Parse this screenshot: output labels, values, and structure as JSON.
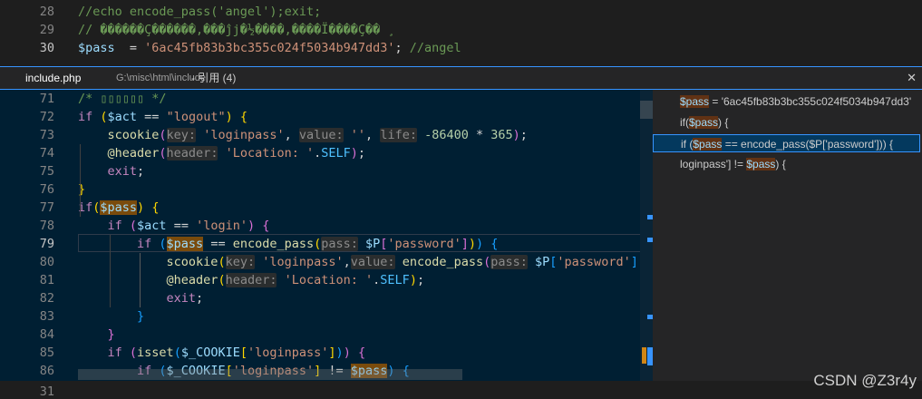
{
  "editor_top": {
    "lines": [
      {
        "num": "28",
        "parts": [
          {
            "t": "//echo encode_pass('angel');exit;",
            "c": "cm"
          }
        ]
      },
      {
        "num": "29",
        "parts": [
          {
            "t": "// ������Ç������,���ĵj�½����,����Ï����Ç�� ¸",
            "c": "cm"
          }
        ]
      },
      {
        "num": "30",
        "parts": [
          {
            "t": "$pass",
            "c": "var"
          },
          {
            "t": "  = ",
            "c": "op"
          },
          {
            "t": "'6ac45fb83b3bc355c024f5034b947dd3'",
            "c": "str"
          },
          {
            "t": "; ",
            "c": "op"
          },
          {
            "t": "//angel",
            "c": "cm"
          }
        ]
      }
    ]
  },
  "editor_bottom": {
    "num": "31"
  },
  "peek": {
    "file": "include.php",
    "path": "G:\\misc\\html\\include",
    "refs_label": "- 引用 (4)",
    "close_glyph": "✕",
    "lines": [
      {
        "num": "71",
        "parts": [
          {
            "t": "/* ",
            "c": "cm"
          },
          {
            "t": "▯▯▯▯▯▯",
            "c": "cm"
          },
          {
            "t": " */",
            "c": "cm"
          }
        ]
      },
      {
        "num": "72",
        "parts": [
          {
            "t": "if",
            "c": "kw"
          },
          {
            "t": " (",
            "c": "brk1"
          },
          {
            "t": "$act",
            "c": "var"
          },
          {
            "t": " == ",
            "c": "op"
          },
          {
            "t": "\"logout\"",
            "c": "str"
          },
          {
            "t": ")",
            "c": "brk1"
          },
          {
            "t": " {",
            "c": "brk1"
          }
        ]
      },
      {
        "num": "73",
        "parts": [
          {
            "t": "    scookie",
            "c": "fn"
          },
          {
            "t": "(",
            "c": "brk2"
          },
          {
            "t": "key:",
            "c": "hint"
          },
          {
            "t": " 'loginpass'",
            "c": "str"
          },
          {
            "t": ", ",
            "c": "op"
          },
          {
            "t": "value:",
            "c": "hint"
          },
          {
            "t": " ''",
            "c": "str"
          },
          {
            "t": ", ",
            "c": "op"
          },
          {
            "t": "life:",
            "c": "hint"
          },
          {
            "t": " -86400",
            "c": "num"
          },
          {
            "t": " * ",
            "c": "op"
          },
          {
            "t": "365",
            "c": "num"
          },
          {
            "t": ")",
            "c": "brk2"
          },
          {
            "t": ";",
            "c": "op"
          }
        ]
      },
      {
        "num": "74",
        "parts": [
          {
            "t": "    @header",
            "c": "fn"
          },
          {
            "t": "(",
            "c": "brk2"
          },
          {
            "t": "header:",
            "c": "hint"
          },
          {
            "t": " 'Location: '",
            "c": "str"
          },
          {
            "t": ".",
            "c": "op"
          },
          {
            "t": "SELF",
            "c": "const"
          },
          {
            "t": ")",
            "c": "brk2"
          },
          {
            "t": ";",
            "c": "op"
          }
        ]
      },
      {
        "num": "75",
        "parts": [
          {
            "t": "    exit",
            "c": "kw"
          },
          {
            "t": ";",
            "c": "op"
          }
        ]
      },
      {
        "num": "76",
        "parts": [
          {
            "t": "}",
            "c": "brk1"
          }
        ]
      },
      {
        "num": "77",
        "parts": [
          {
            "t": "if",
            "c": "kw"
          },
          {
            "t": "(",
            "c": "brk1"
          },
          {
            "t": "$pass",
            "c": "var",
            "h": true
          },
          {
            "t": ")",
            "c": "brk1"
          },
          {
            "t": " {",
            "c": "brk1"
          }
        ]
      },
      {
        "num": "78",
        "parts": [
          {
            "t": "    if",
            "c": "kw"
          },
          {
            "t": " (",
            "c": "brk2"
          },
          {
            "t": "$act",
            "c": "var"
          },
          {
            "t": " == ",
            "c": "op"
          },
          {
            "t": "'login'",
            "c": "str"
          },
          {
            "t": ")",
            "c": "brk2"
          },
          {
            "t": " {",
            "c": "brk2"
          }
        ]
      },
      {
        "num": "79",
        "parts": [
          {
            "t": "        if",
            "c": "kw"
          },
          {
            "t": " (",
            "c": "brk3"
          },
          {
            "t": "$pass",
            "c": "var",
            "h": true
          },
          {
            "t": " == ",
            "c": "op"
          },
          {
            "t": "encode_pass",
            "c": "fn"
          },
          {
            "t": "(",
            "c": "brk1"
          },
          {
            "t": "pass:",
            "c": "hint"
          },
          {
            "t": " $P",
            "c": "var"
          },
          {
            "t": "[",
            "c": "brk2"
          },
          {
            "t": "'password'",
            "c": "str"
          },
          {
            "t": "]",
            "c": "brk2"
          },
          {
            "t": ")",
            "c": "brk1"
          },
          {
            "t": ")",
            "c": "brk3"
          },
          {
            "t": " {",
            "c": "brk3"
          }
        ]
      },
      {
        "num": "80",
        "parts": [
          {
            "t": "            scookie",
            "c": "fn"
          },
          {
            "t": "(",
            "c": "brk1"
          },
          {
            "t": "key:",
            "c": "hint"
          },
          {
            "t": " 'loginpass'",
            "c": "str"
          },
          {
            "t": ",",
            "c": "op"
          },
          {
            "t": "value:",
            "c": "hint"
          },
          {
            "t": " encode_pass",
            "c": "fn"
          },
          {
            "t": "(",
            "c": "brk2"
          },
          {
            "t": "pass:",
            "c": "hint"
          },
          {
            "t": " $P",
            "c": "var"
          },
          {
            "t": "[",
            "c": "brk3"
          },
          {
            "t": "'password'",
            "c": "str"
          },
          {
            "t": "]",
            "c": "brk3"
          },
          {
            "t": ")",
            "c": "brk2"
          },
          {
            "t": ",",
            "c": "op"
          }
        ]
      },
      {
        "num": "81",
        "parts": [
          {
            "t": "            @header",
            "c": "fn"
          },
          {
            "t": "(",
            "c": "brk1"
          },
          {
            "t": "header:",
            "c": "hint"
          },
          {
            "t": " 'Location: '",
            "c": "str"
          },
          {
            "t": ".",
            "c": "op"
          },
          {
            "t": "SELF",
            "c": "const"
          },
          {
            "t": ")",
            "c": "brk1"
          },
          {
            "t": ";",
            "c": "op"
          }
        ]
      },
      {
        "num": "82",
        "parts": [
          {
            "t": "            exit",
            "c": "kw"
          },
          {
            "t": ";",
            "c": "op"
          }
        ]
      },
      {
        "num": "83",
        "parts": [
          {
            "t": "        }",
            "c": "brk3"
          }
        ]
      },
      {
        "num": "84",
        "parts": [
          {
            "t": "    }",
            "c": "brk2"
          }
        ]
      },
      {
        "num": "85",
        "parts": [
          {
            "t": "    if",
            "c": "kw"
          },
          {
            "t": " (",
            "c": "brk2"
          },
          {
            "t": "isset",
            "c": "fn"
          },
          {
            "t": "(",
            "c": "brk3"
          },
          {
            "t": "$_COOKIE",
            "c": "var"
          },
          {
            "t": "[",
            "c": "brk1"
          },
          {
            "t": "'loginpass'",
            "c": "str"
          },
          {
            "t": "]",
            "c": "brk1"
          },
          {
            "t": ")",
            "c": "brk3"
          },
          {
            "t": ")",
            "c": "brk2"
          },
          {
            "t": " {",
            "c": "brk2"
          }
        ]
      },
      {
        "num": "86",
        "parts": [
          {
            "t": "        if",
            "c": "kw"
          },
          {
            "t": " (",
            "c": "brk3"
          },
          {
            "t": "$_COOKIE",
            "c": "var"
          },
          {
            "t": "[",
            "c": "brk1"
          },
          {
            "t": "'loginpass'",
            "c": "str"
          },
          {
            "t": "]",
            "c": "brk1"
          },
          {
            "t": " != ",
            "c": "op"
          },
          {
            "t": "$pass",
            "c": "var",
            "h": true
          },
          {
            "t": ")",
            "c": "brk3"
          },
          {
            "t": " {",
            "c": "brk3"
          }
        ]
      }
    ],
    "references": [
      {
        "parts": [
          {
            "t": "$pass",
            "m": true
          },
          {
            "t": " = '6ac45fb83b3bc355c024f5034b947dd3'"
          }
        ]
      },
      {
        "parts": [
          {
            "t": "if("
          },
          {
            "t": "$pass",
            "m": true
          },
          {
            "t": ") {"
          }
        ]
      },
      {
        "parts": [
          {
            "t": "if ("
          },
          {
            "t": "$pass",
            "m": true
          },
          {
            "t": " == encode_pass($P['password'])) {"
          }
        ]
      },
      {
        "parts": [
          {
            "t": "loginpass'] != "
          },
          {
            "t": "$pass",
            "m": true
          },
          {
            "t": ") {"
          }
        ]
      }
    ]
  },
  "watermark": "CSDN @Z3r4y"
}
